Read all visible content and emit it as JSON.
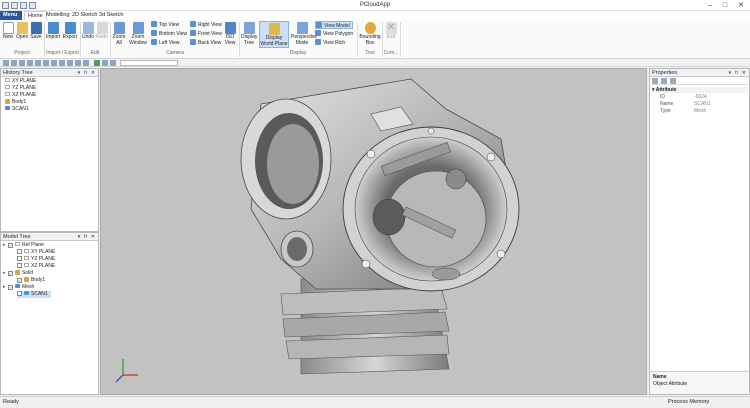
{
  "window": {
    "title": "PCloudApp",
    "controls": [
      "–",
      "□",
      "✕"
    ]
  },
  "tabs": [
    {
      "label": "Menu"
    },
    {
      "label": "Home"
    },
    {
      "label": "Modelling"
    },
    {
      "label": "2D Sketch"
    },
    {
      "label": "3d Sketch"
    }
  ],
  "ribbon": {
    "project": {
      "group": "Project",
      "new": "New",
      "open": "Open",
      "save": "Save"
    },
    "import_export": {
      "group": "Import / Export",
      "import": "Import",
      "export": "Export"
    },
    "edit": {
      "group": "Edit",
      "undo": "Undo",
      "redo": "Redo"
    },
    "camera": {
      "group": "Camera",
      "zoom_all": "Zoom All",
      "zoom_window": "Zoom Window",
      "top_view": "Top View",
      "bottom_view": "Bottom View",
      "left_view": "Left View",
      "right_view": "Right View",
      "front_view": "Front View",
      "back_view": "Back View",
      "iso_view": "ISO View"
    },
    "display": {
      "group": "Display",
      "display_tree": "Display Tree",
      "display_world_plane": "Display World Plane",
      "perspective_mode": "Perspective Mode",
      "view_model": "View Model",
      "view_polygon": "View Polygon",
      "view_rich": "View Rich"
    },
    "tool": {
      "group": "Tool",
      "bounding_box": "Bounding Box"
    },
    "com": {
      "group": "Com...",
      "exit": "Exit"
    }
  },
  "history_tree": {
    "title": "History Tree",
    "items": [
      "XY PLANE",
      "YZ PLANE",
      "XZ PLANE",
      "Body1",
      "SCAN1"
    ]
  },
  "model_tree": {
    "title": "Model Tree",
    "ref_plane": "Ref Plane",
    "planes": [
      "XY PLANE",
      "YZ PLANE",
      "XZ PLANE"
    ],
    "solid": "Solid",
    "body": "Body1",
    "mesh": "Mesh",
    "scan": "SCAN1"
  },
  "properties": {
    "title": "Properties",
    "section": "Attribute",
    "rows": [
      {
        "key": "ID",
        "value": "-9024"
      },
      {
        "key": "Name",
        "value": "SCAN1"
      },
      {
        "key": "Type",
        "value": "Mesh"
      }
    ],
    "footer_title": "Name",
    "footer_desc": "Object Attribute"
  },
  "status": {
    "left": "Ready",
    "right": "Process Memory"
  },
  "colors": {
    "menu_tab": "#2b579a",
    "viewport_bg": "#c2c2c2",
    "selection": "#cce0f5"
  }
}
